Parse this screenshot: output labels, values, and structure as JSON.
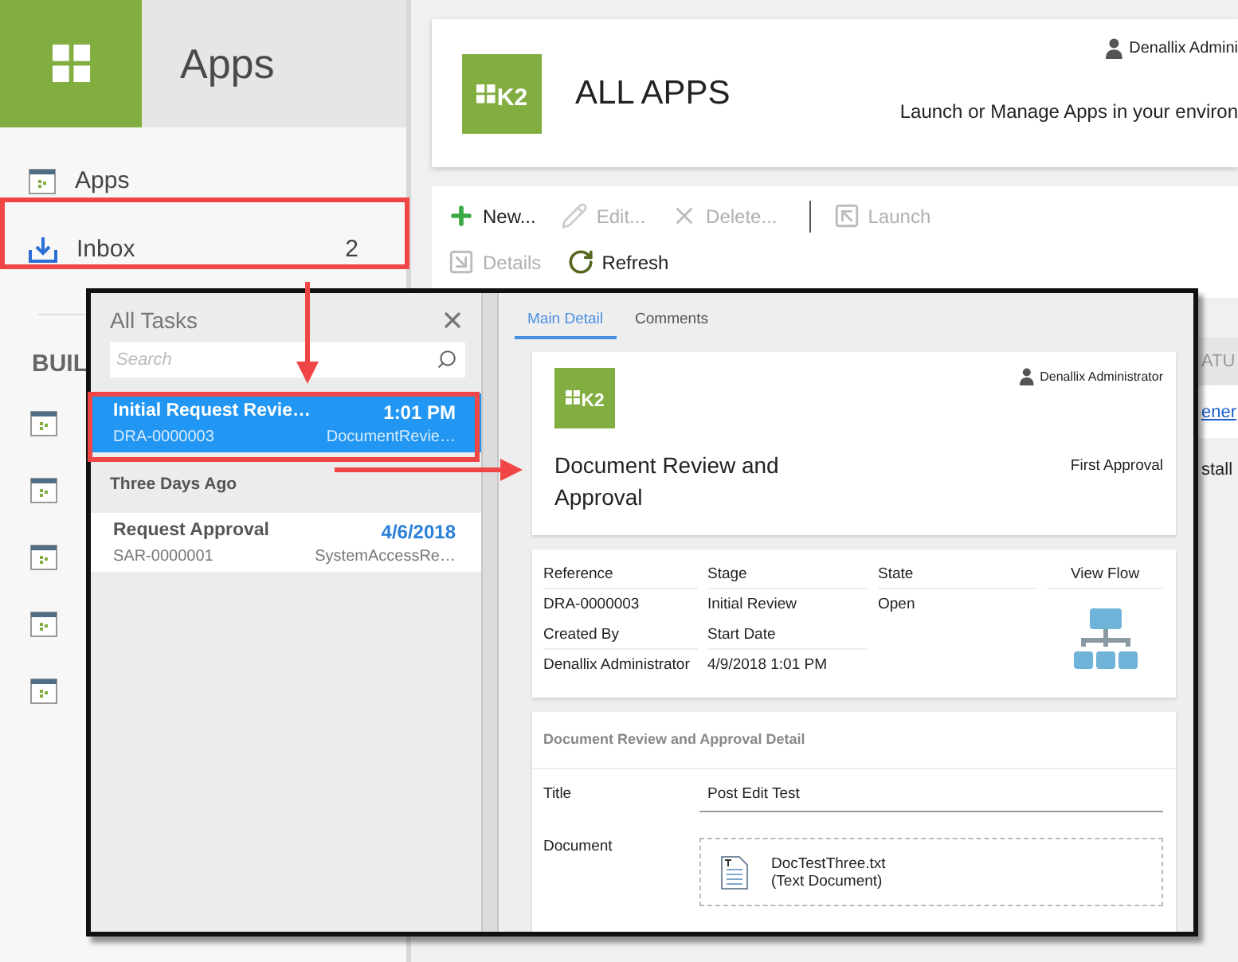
{
  "sidebar": {
    "title": "Apps",
    "nav": [
      {
        "label": "Apps",
        "kind": "apps"
      },
      {
        "label": "Inbox",
        "kind": "inbox",
        "count": "2"
      }
    ],
    "section": "BUIL",
    "section_items": [
      {
        "kind": "app"
      },
      {
        "kind": "app"
      },
      {
        "kind": "app"
      },
      {
        "kind": "app"
      },
      {
        "kind": "app"
      }
    ]
  },
  "header": {
    "logo_text": "K2",
    "title": "ALL APPS",
    "user": "Denallix Admini",
    "subtitle": "Launch or Manage Apps in your environ"
  },
  "toolbar": [
    [
      {
        "kind": "new",
        "label": "New...",
        "disabled": false
      },
      {
        "kind": "edit",
        "label": "Edit...",
        "disabled": true
      },
      {
        "kind": "delete",
        "label": "Delete...",
        "disabled": true
      },
      {
        "kind": "separator"
      },
      {
        "kind": "launch",
        "label": "Launch",
        "disabled": true
      }
    ],
    [
      {
        "kind": "details",
        "label": "Details",
        "disabled": true
      },
      {
        "kind": "refresh",
        "label": "Refresh",
        "disabled": false
      }
    ]
  ],
  "table_behind": {
    "column_heading": "ATU",
    "link": "ener",
    "cell": "stall"
  },
  "tasks_panel": {
    "title": "All Tasks",
    "search": {
      "placeholder": "Search"
    },
    "entries": [
      {
        "kind": "task",
        "title": "Initial Request Revie…",
        "time": "1:01 PM",
        "reference": "DRA-0000003",
        "process": "DocumentRevie…",
        "selected": true
      },
      {
        "kind": "heading",
        "label": "Three Days Ago"
      },
      {
        "kind": "task",
        "title": "Request Approval",
        "time": "4/6/2018",
        "reference": "SAR-0000001",
        "process": "SystemAccessRe…",
        "selected": false
      }
    ]
  },
  "detail": {
    "tabs": [
      {
        "label": "Main Detail",
        "selected": true
      },
      {
        "label": "Comments",
        "selected": false
      }
    ],
    "summary": {
      "logo_text": "K2",
      "user": "Denallix Administrator",
      "title": "Document Review and Approval",
      "activity": "First Approval"
    },
    "fields": [
      [
        {
          "label": "Reference",
          "value": "DRA-0000003"
        },
        {
          "label": "Stage",
          "value": "Initial Review"
        },
        {
          "label": "State",
          "value": "Open"
        }
      ],
      [
        {
          "label": "Created By",
          "value": "Denallix Administrator"
        },
        {
          "label": "Start Date",
          "value": "4/9/2018 1:01 PM"
        }
      ]
    ],
    "view_flow": "View Flow",
    "form": {
      "heading": "Document Review and Approval Detail",
      "rows": [
        {
          "kind": "text",
          "label": "Title",
          "value": "Post Edit Test"
        },
        {
          "kind": "file",
          "label": "Document",
          "file_name": "DocTestThree.txt",
          "file_type": "(Text Document)"
        }
      ]
    }
  }
}
